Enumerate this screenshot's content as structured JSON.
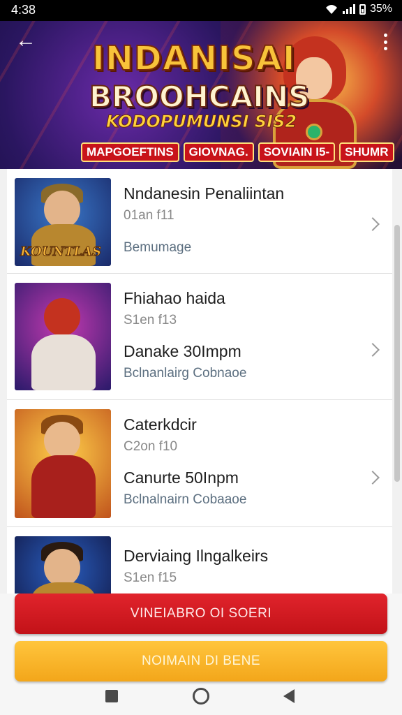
{
  "status_bar": {
    "time": "4:38",
    "battery": "35%"
  },
  "banner": {
    "title": "INDANISAI",
    "subtitle": "BROOHCAINS",
    "tagline": "KODOPUMUNSI SIS2",
    "tags": [
      "MAPGOEFTINS",
      "GIOVNAG.",
      "SOVIAIN I5-",
      "SHUMR"
    ]
  },
  "items": [
    {
      "title": "Nndanesin Penaliintan",
      "subtitle": "01an f11",
      "line": "",
      "tag": "Bemumage"
    },
    {
      "title": "Fhiahao haida",
      "subtitle": "S1en f13",
      "line": "Danake 30Impm",
      "tag": "Bclnanlairg Cobnaoe"
    },
    {
      "title": "Caterkdcir",
      "subtitle": "C2on f10",
      "line": "Canurte 50Inpm",
      "tag": "Bclnalnairn Cobaaoe"
    },
    {
      "title": "Derviaing Ilngalkeirs",
      "subtitle": "S1en f15",
      "line": "",
      "tag": ""
    }
  ],
  "thumb_logo": "KOUNTLAS",
  "actions": {
    "primary_label": "VINEIABRO OI SOERI",
    "secondary_label": "NOIMAIN DI BENE"
  },
  "colors": {
    "primary": "#c8131a",
    "secondary": "#f6b02a",
    "banner_bg": "#1a1246"
  },
  "icons": [
    "back-icon",
    "more-icon",
    "chevron-right-icon",
    "nav-recents-icon",
    "nav-home-icon",
    "nav-back-icon"
  ]
}
